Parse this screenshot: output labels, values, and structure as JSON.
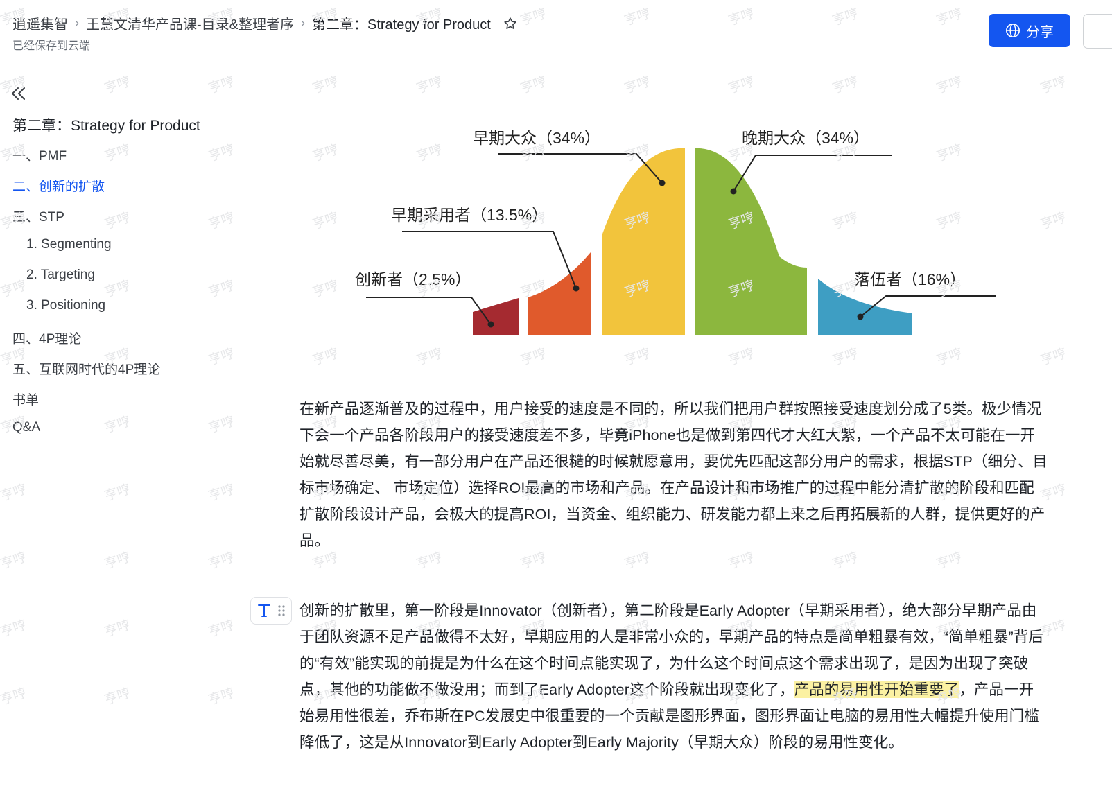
{
  "header": {
    "breadcrumbs": [
      "逍遥集智",
      "王慧文清华产品课-目录&整理者序",
      "第二章：Strategy for Product"
    ],
    "saved_status": "已经保存到云端",
    "share_label": "分享"
  },
  "sidebar": {
    "title": "第二章：Strategy for Product",
    "items": [
      {
        "label": "一、PMF",
        "level": 0,
        "active": false
      },
      {
        "label": "二、创新的扩散",
        "level": 0,
        "active": true
      },
      {
        "label": "三、STP",
        "level": 0,
        "active": false
      },
      {
        "label": "1. Segmenting",
        "level": 1,
        "active": false
      },
      {
        "label": "2. Targeting",
        "level": 1,
        "active": false
      },
      {
        "label": "3. Positioning",
        "level": 1,
        "active": false
      },
      {
        "label": "四、4P理论",
        "level": 0,
        "active": false
      },
      {
        "label": "五、互联网时代的4P理论",
        "level": 0,
        "active": false
      },
      {
        "label": "书单",
        "level": 0,
        "active": false
      },
      {
        "label": "Q&A",
        "level": 0,
        "active": false
      }
    ]
  },
  "chart_data": {
    "type": "area",
    "title": "",
    "segments": [
      {
        "label": "创新者（2.5%）",
        "value": 2.5,
        "color": "#a52a30"
      },
      {
        "label": "早期采用者（13.5%）",
        "value": 13.5,
        "color": "#e05a2c"
      },
      {
        "label": "早期大众（34%）",
        "value": 34,
        "color": "#f2c43c"
      },
      {
        "label": "晚期大众（34%）",
        "value": 34,
        "color": "#8cb73e"
      },
      {
        "label": "落伍者（16%）",
        "value": 16,
        "color": "#3e9ec3"
      }
    ]
  },
  "content": {
    "paragraph1": "在新产品逐渐普及的过程中，用户接受的速度是不同的，所以我们把用户群按照接受速度划分成了5类。极少情况下会一个产品各阶段用户的接受速度差不多，毕竟iPhone也是做到第四代才大红大紫，一个产品不太可能在一开始就尽善尽美，有一部分用户在产品还很糙的时候就愿意用，要优先匹配这部分用户的需求，根据STP（细分、目标市场确定、 市场定位）选择ROI最高的市场和产品。在产品设计和市场推广的过程中能分清扩散的阶段和匹配扩散阶段设计产品，会极大的提高ROI，当资金、组织能力、研发能力都上来之后再拓展新的人群，提供更好的产品。",
    "paragraph2_before": "创新的扩散里，第一阶段是Innovator（创新者），第二阶段是Early Adopter（早期采用者），绝大部分早期产品由于团队资源不足产品做得不太好，早期应用的人是非常小众的，早期产品的特点是简单粗暴有效，“简单粗暴”背后的“有效”能实现的前提是为什么在这个时间点能实现了，为什么这个时间点这个需求出现了，是因为出现了突破点，其他的功能做不做没用；而到了Early Adopter这个阶段就出现变化了，",
    "paragraph2_highlight": "产品的易用性开始重要了",
    "paragraph2_after": "，产品一开始易用性很差，乔布斯在PC发展史中很重要的一个贡献是图形界面，图形界面让电脑的易用性大幅提升使用门槛降低了，这是从Innovator到Early Adopter到Early Majority（早期大众）阶段的易用性变化。"
  },
  "watermark": "亨哼",
  "colors": {
    "accent": "#1456f0",
    "highlight": "#fbf1a2"
  }
}
